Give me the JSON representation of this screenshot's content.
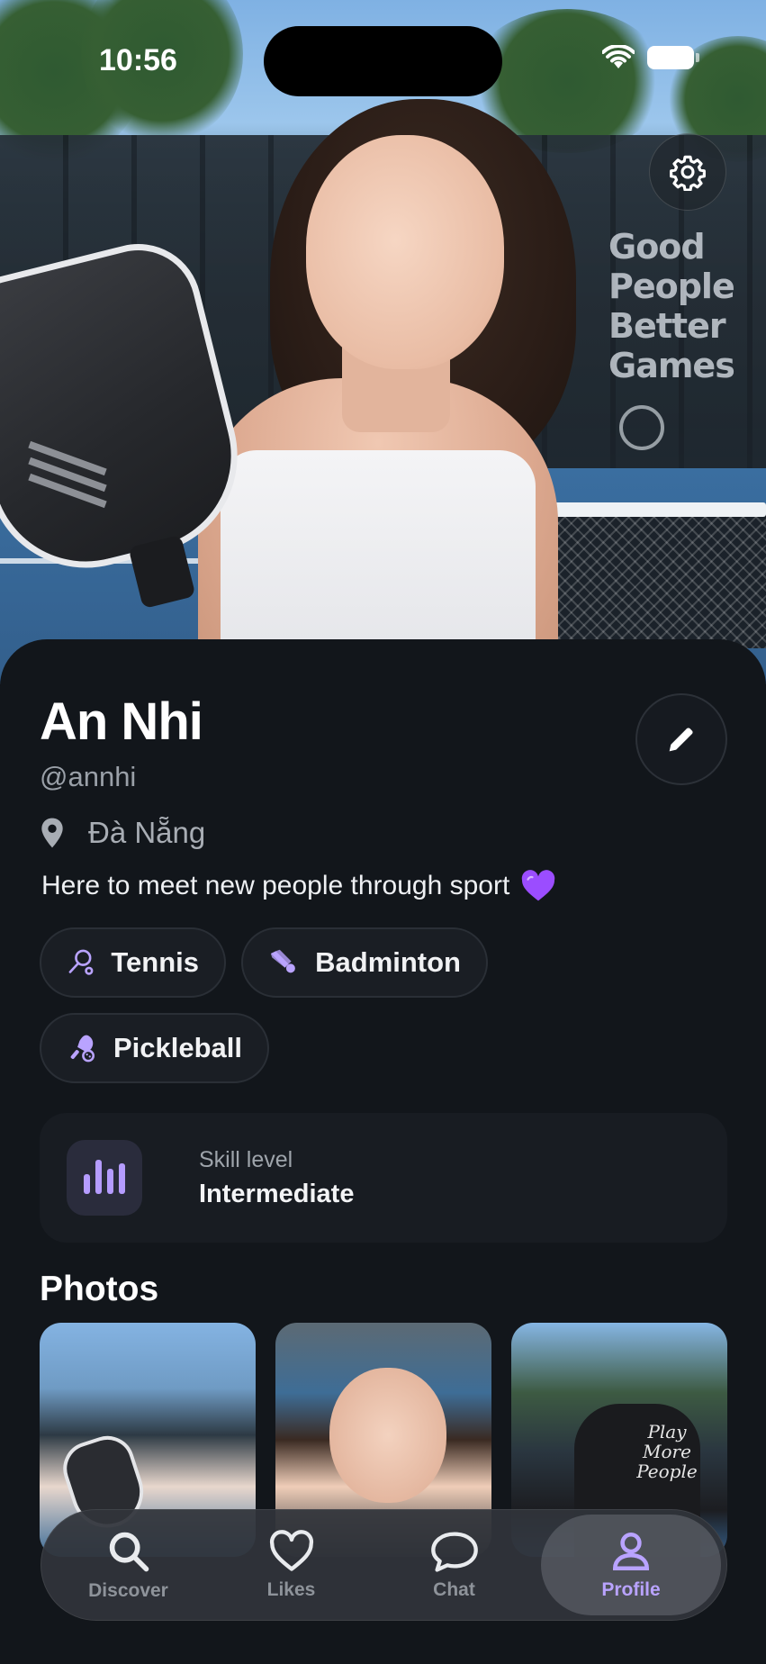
{
  "status_bar": {
    "time": "10:56"
  },
  "hero": {
    "sign_lines": [
      "Good",
      "People",
      "Better",
      "Games"
    ],
    "icons": {
      "settings": "gear-icon"
    }
  },
  "profile": {
    "name": "An Nhi",
    "handle": "@annhi",
    "location": "Đà Nẵng",
    "bio": "Here to meet new people through sport",
    "bio_emoji": "💜",
    "sports": [
      {
        "label": "Tennis",
        "icon": "tennis-racket-icon"
      },
      {
        "label": "Badminton",
        "icon": "shuttlecock-icon"
      },
      {
        "label": "Pickleball",
        "icon": "pickleball-paddle-icon"
      }
    ],
    "skill": {
      "label": "Skill level",
      "value": "Intermediate",
      "icon": "bar-chart-icon"
    },
    "photos_title": "Photos",
    "photo_shirt_text": [
      "Play",
      "More",
      "People"
    ]
  },
  "tabs": [
    {
      "label": "Discover",
      "icon": "search-icon",
      "active": false
    },
    {
      "label": "Likes",
      "icon": "heart-icon",
      "active": false
    },
    {
      "label": "Chat",
      "icon": "chat-bubble-icon",
      "active": false
    },
    {
      "label": "Profile",
      "icon": "person-icon",
      "active": true
    }
  ],
  "colors": {
    "accent": "#b9a3ff",
    "background": "#12161b",
    "chip": "#1a1e24"
  }
}
